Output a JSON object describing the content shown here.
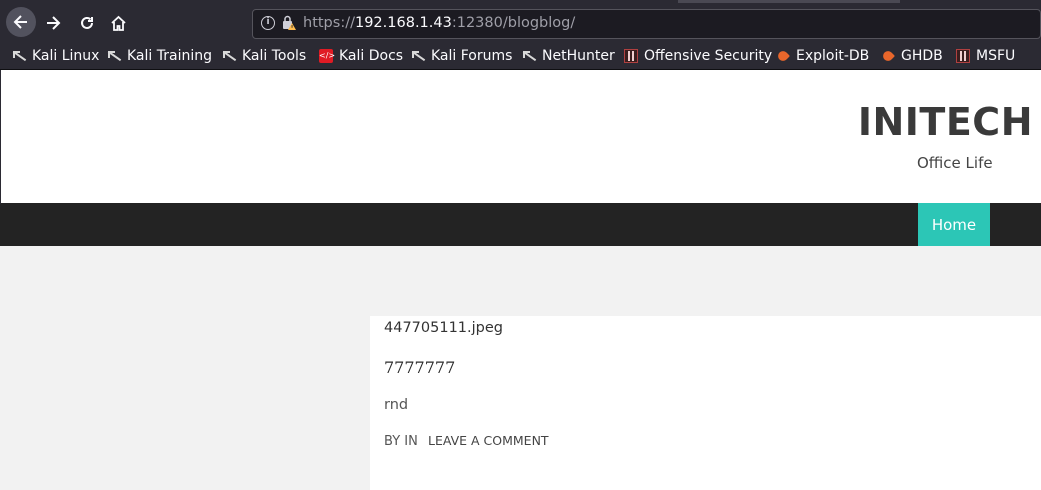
{
  "browser": {
    "url_prefix": "https://",
    "url_host": "192.168.1.43",
    "url_rest": ":12380/blogblog/"
  },
  "bookmarks": [
    {
      "label": "Kali Linux",
      "icon": "kali-dragon-icon"
    },
    {
      "label": "Kali Training",
      "icon": "kali-dragon-icon"
    },
    {
      "label": "Kali Tools",
      "icon": "kali-dragon-icon"
    },
    {
      "label": "Kali Docs",
      "icon": "kali-docs-icon"
    },
    {
      "label": "Kali Forums",
      "icon": "kali-dragon-icon"
    },
    {
      "label": "NetHunter",
      "icon": "kali-dragon-icon"
    },
    {
      "label": "Offensive Security",
      "icon": "offsec-icon"
    },
    {
      "label": "Exploit-DB",
      "icon": "exploitdb-icon"
    },
    {
      "label": "GHDB",
      "icon": "exploitdb-icon"
    },
    {
      "label": "MSFU",
      "icon": "offsec-icon"
    }
  ],
  "site": {
    "title": "INITECH",
    "tagline": "Office Life"
  },
  "menu": {
    "home_label": "Home",
    "active_color": "#2cc6b6"
  },
  "post": {
    "file_name": "447705111.jpeg",
    "title": "7777777",
    "category": "rnd",
    "meta_by": "BY IN",
    "leave_comment": "LEAVE A COMMENT"
  }
}
